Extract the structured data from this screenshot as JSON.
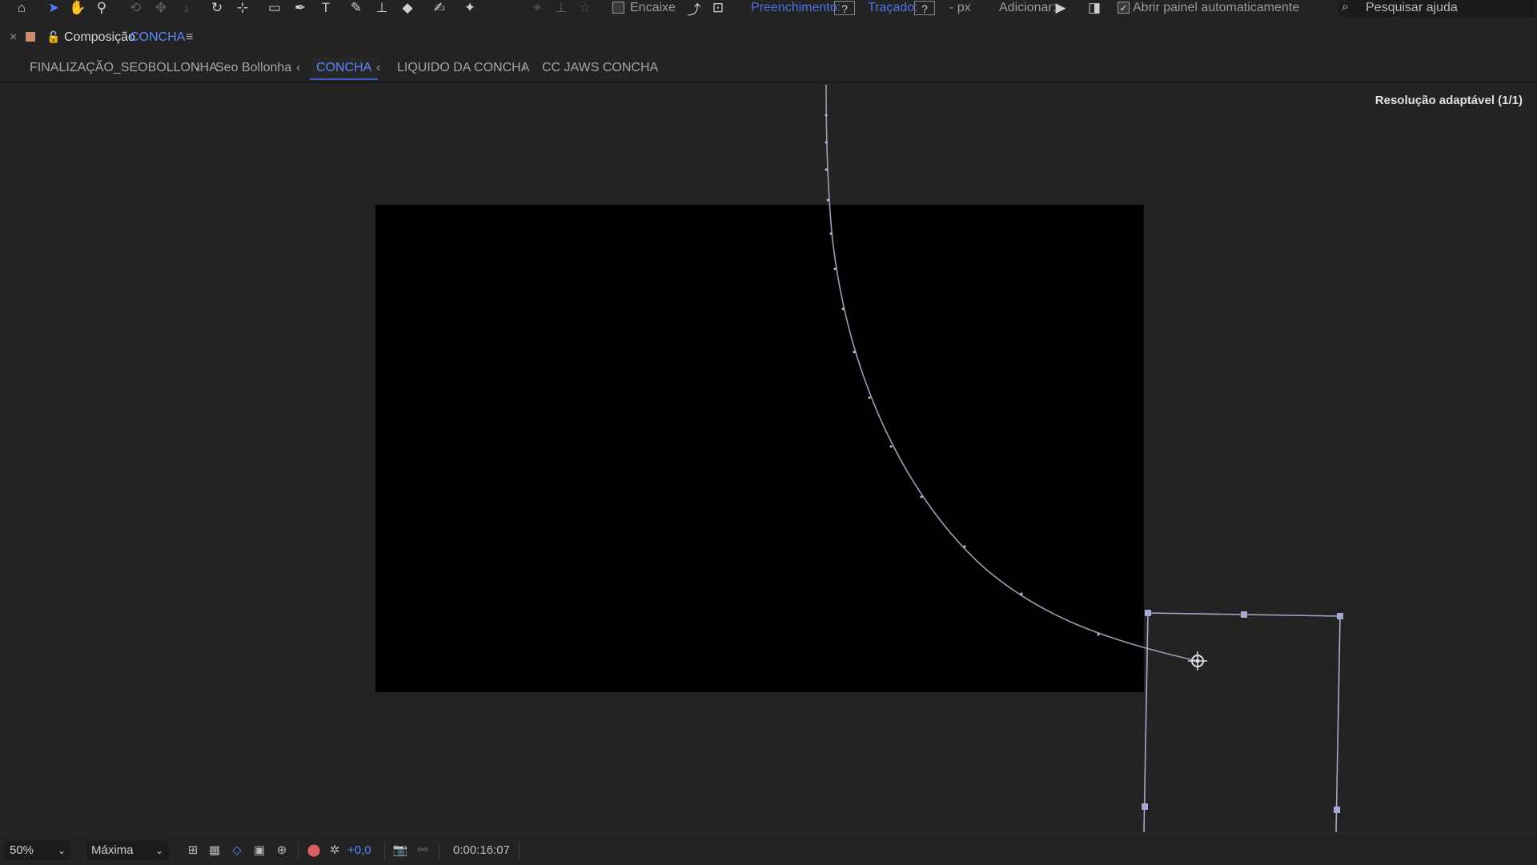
{
  "toolbar": {
    "snap_label": "Encaixe",
    "fill_label": "Preenchimento:",
    "fill_value": "?",
    "stroke_label": "Traçado:",
    "stroke_value": "?",
    "stroke_unit": "- px",
    "add_label": "Adicionar:",
    "auto_open_label": "Abrir painel automaticamente",
    "auto_open_checked": "✓",
    "search_placeholder": "Pesquisar ajuda"
  },
  "panel": {
    "close_glyph": "×",
    "title_prefix": "Composição",
    "title_name": "CONCHA",
    "menu_glyph": "≡"
  },
  "breadcrumbs": {
    "items": [
      "FINALIZAÇÃO_SEOBOLLONHA",
      "Seo Bollonha",
      "CONCHA",
      "LIQUIDO DA CONCHA",
      "CC JAWS CONCHA"
    ],
    "separator": "‹",
    "active_index": 2
  },
  "viewer": {
    "resolution_label": "Resolução adaptável (1/1)",
    "canvas_color": "#000000",
    "path_color": "#9aa0b4"
  },
  "bottom_bar": {
    "zoom": "50%",
    "quality": "Máxima",
    "exposure": "+0,0",
    "timecode": "0:00:16:07"
  },
  "colors": {
    "accent": "#4f7dff",
    "background": "#232323"
  },
  "icons": [
    "home-icon",
    "selection-arrow-icon",
    "hand-icon",
    "zoom-icon",
    "orbit-camera-icon",
    "pan-behind-icon",
    "rotate-icon",
    "anchor-icon",
    "rectangle-tool-icon",
    "pen-tool-icon",
    "type-tool-icon",
    "brush-icon",
    "clone-stamp-icon",
    "eraser-icon",
    "roto-brush-icon",
    "puppet-pin-icon",
    "search-icon",
    "lock-icon",
    "camera-icon"
  ]
}
